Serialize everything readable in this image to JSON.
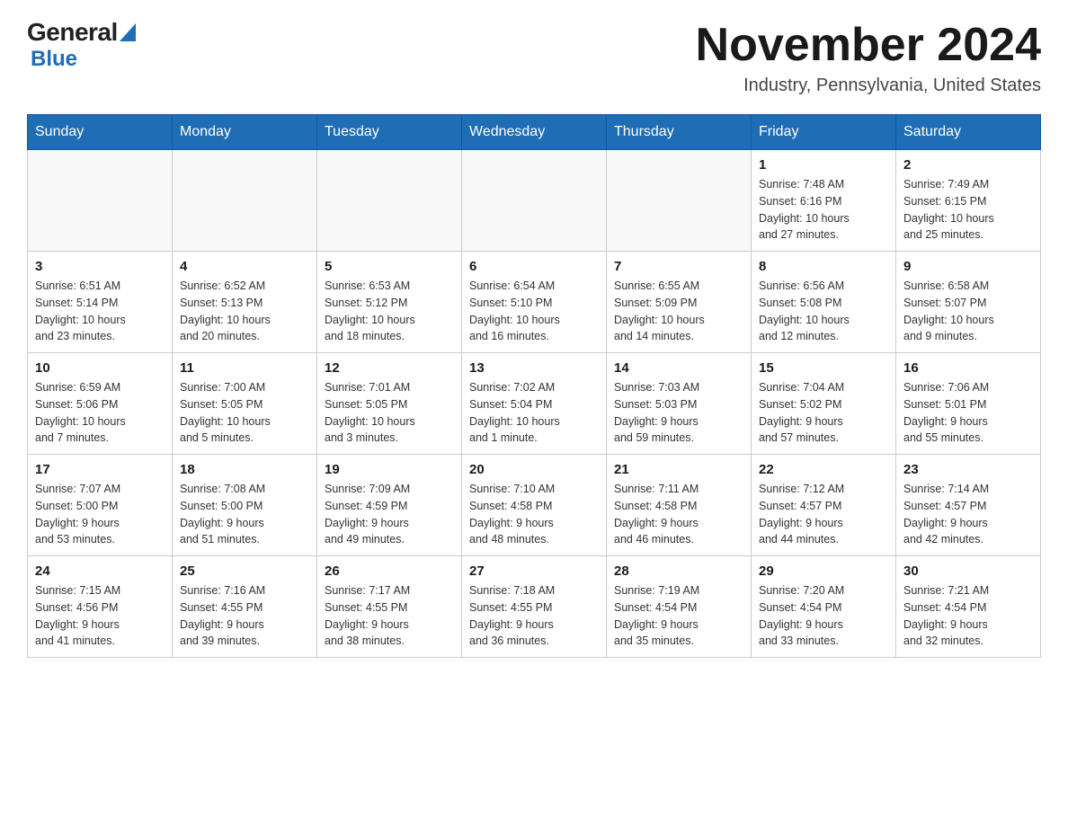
{
  "header": {
    "month_title": "November 2024",
    "location": "Industry, Pennsylvania, United States"
  },
  "logo": {
    "general": "General",
    "blue": "Blue"
  },
  "days_of_week": [
    "Sunday",
    "Monday",
    "Tuesday",
    "Wednesday",
    "Thursday",
    "Friday",
    "Saturday"
  ],
  "weeks": [
    [
      {
        "day": "",
        "info": ""
      },
      {
        "day": "",
        "info": ""
      },
      {
        "day": "",
        "info": ""
      },
      {
        "day": "",
        "info": ""
      },
      {
        "day": "",
        "info": ""
      },
      {
        "day": "1",
        "info": "Sunrise: 7:48 AM\nSunset: 6:16 PM\nDaylight: 10 hours\nand 27 minutes."
      },
      {
        "day": "2",
        "info": "Sunrise: 7:49 AM\nSunset: 6:15 PM\nDaylight: 10 hours\nand 25 minutes."
      }
    ],
    [
      {
        "day": "3",
        "info": "Sunrise: 6:51 AM\nSunset: 5:14 PM\nDaylight: 10 hours\nand 23 minutes."
      },
      {
        "day": "4",
        "info": "Sunrise: 6:52 AM\nSunset: 5:13 PM\nDaylight: 10 hours\nand 20 minutes."
      },
      {
        "day": "5",
        "info": "Sunrise: 6:53 AM\nSunset: 5:12 PM\nDaylight: 10 hours\nand 18 minutes."
      },
      {
        "day": "6",
        "info": "Sunrise: 6:54 AM\nSunset: 5:10 PM\nDaylight: 10 hours\nand 16 minutes."
      },
      {
        "day": "7",
        "info": "Sunrise: 6:55 AM\nSunset: 5:09 PM\nDaylight: 10 hours\nand 14 minutes."
      },
      {
        "day": "8",
        "info": "Sunrise: 6:56 AM\nSunset: 5:08 PM\nDaylight: 10 hours\nand 12 minutes."
      },
      {
        "day": "9",
        "info": "Sunrise: 6:58 AM\nSunset: 5:07 PM\nDaylight: 10 hours\nand 9 minutes."
      }
    ],
    [
      {
        "day": "10",
        "info": "Sunrise: 6:59 AM\nSunset: 5:06 PM\nDaylight: 10 hours\nand 7 minutes."
      },
      {
        "day": "11",
        "info": "Sunrise: 7:00 AM\nSunset: 5:05 PM\nDaylight: 10 hours\nand 5 minutes."
      },
      {
        "day": "12",
        "info": "Sunrise: 7:01 AM\nSunset: 5:05 PM\nDaylight: 10 hours\nand 3 minutes."
      },
      {
        "day": "13",
        "info": "Sunrise: 7:02 AM\nSunset: 5:04 PM\nDaylight: 10 hours\nand 1 minute."
      },
      {
        "day": "14",
        "info": "Sunrise: 7:03 AM\nSunset: 5:03 PM\nDaylight: 9 hours\nand 59 minutes."
      },
      {
        "day": "15",
        "info": "Sunrise: 7:04 AM\nSunset: 5:02 PM\nDaylight: 9 hours\nand 57 minutes."
      },
      {
        "day": "16",
        "info": "Sunrise: 7:06 AM\nSunset: 5:01 PM\nDaylight: 9 hours\nand 55 minutes."
      }
    ],
    [
      {
        "day": "17",
        "info": "Sunrise: 7:07 AM\nSunset: 5:00 PM\nDaylight: 9 hours\nand 53 minutes."
      },
      {
        "day": "18",
        "info": "Sunrise: 7:08 AM\nSunset: 5:00 PM\nDaylight: 9 hours\nand 51 minutes."
      },
      {
        "day": "19",
        "info": "Sunrise: 7:09 AM\nSunset: 4:59 PM\nDaylight: 9 hours\nand 49 minutes."
      },
      {
        "day": "20",
        "info": "Sunrise: 7:10 AM\nSunset: 4:58 PM\nDaylight: 9 hours\nand 48 minutes."
      },
      {
        "day": "21",
        "info": "Sunrise: 7:11 AM\nSunset: 4:58 PM\nDaylight: 9 hours\nand 46 minutes."
      },
      {
        "day": "22",
        "info": "Sunrise: 7:12 AM\nSunset: 4:57 PM\nDaylight: 9 hours\nand 44 minutes."
      },
      {
        "day": "23",
        "info": "Sunrise: 7:14 AM\nSunset: 4:57 PM\nDaylight: 9 hours\nand 42 minutes."
      }
    ],
    [
      {
        "day": "24",
        "info": "Sunrise: 7:15 AM\nSunset: 4:56 PM\nDaylight: 9 hours\nand 41 minutes."
      },
      {
        "day": "25",
        "info": "Sunrise: 7:16 AM\nSunset: 4:55 PM\nDaylight: 9 hours\nand 39 minutes."
      },
      {
        "day": "26",
        "info": "Sunrise: 7:17 AM\nSunset: 4:55 PM\nDaylight: 9 hours\nand 38 minutes."
      },
      {
        "day": "27",
        "info": "Sunrise: 7:18 AM\nSunset: 4:55 PM\nDaylight: 9 hours\nand 36 minutes."
      },
      {
        "day": "28",
        "info": "Sunrise: 7:19 AM\nSunset: 4:54 PM\nDaylight: 9 hours\nand 35 minutes."
      },
      {
        "day": "29",
        "info": "Sunrise: 7:20 AM\nSunset: 4:54 PM\nDaylight: 9 hours\nand 33 minutes."
      },
      {
        "day": "30",
        "info": "Sunrise: 7:21 AM\nSunset: 4:54 PM\nDaylight: 9 hours\nand 32 minutes."
      }
    ]
  ]
}
